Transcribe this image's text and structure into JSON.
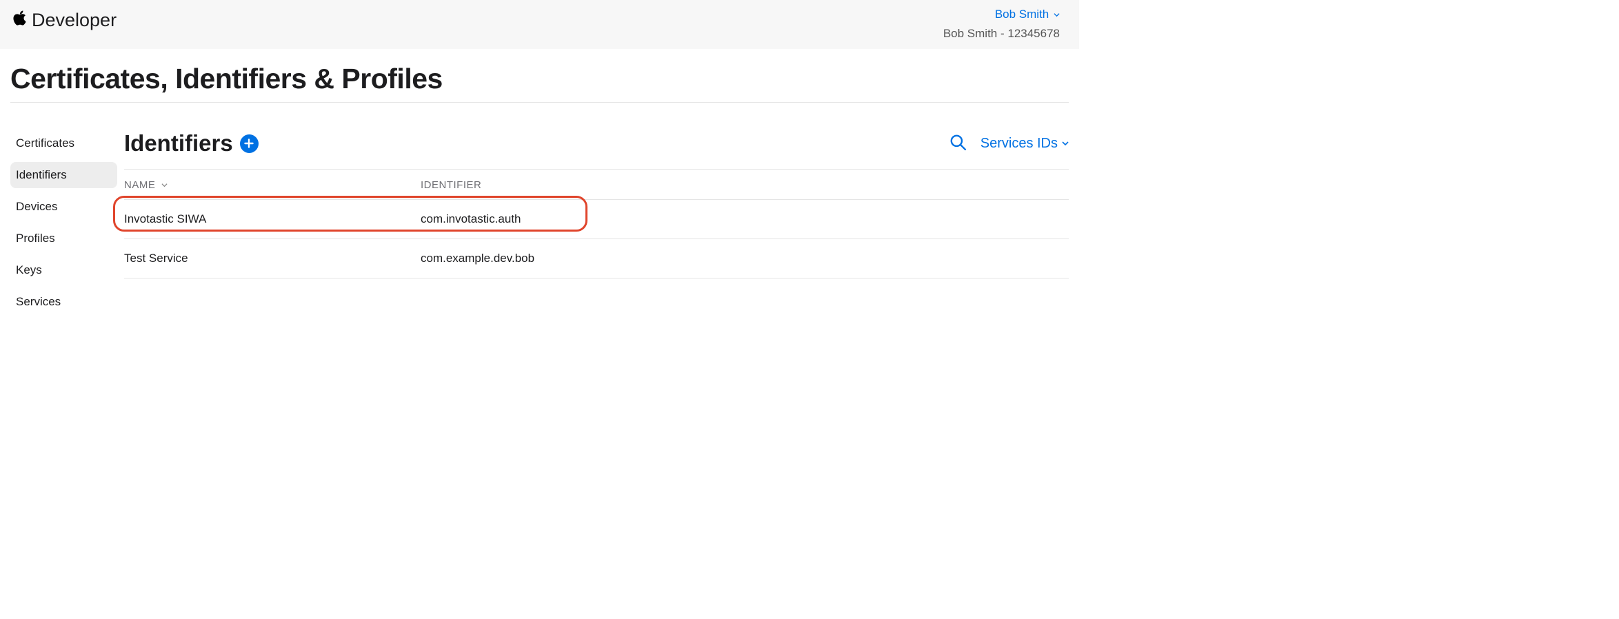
{
  "header": {
    "brand": "Developer",
    "user_name": "Bob Smith",
    "team_label": "Bob Smith - 12345678"
  },
  "page": {
    "title": "Certificates, Identifiers & Profiles",
    "section_title": "Identifiers",
    "filter_label": "Services IDs"
  },
  "sidebar": {
    "items": [
      {
        "label": "Certificates"
      },
      {
        "label": "Identifiers"
      },
      {
        "label": "Devices"
      },
      {
        "label": "Profiles"
      },
      {
        "label": "Keys"
      },
      {
        "label": "Services"
      }
    ]
  },
  "table": {
    "columns": {
      "name": "NAME",
      "identifier": "IDENTIFIER"
    },
    "rows": [
      {
        "name": "Invotastic SIWA",
        "identifier": "com.invotastic.auth"
      },
      {
        "name": "Test Service",
        "identifier": "com.example.dev.bob"
      }
    ]
  }
}
